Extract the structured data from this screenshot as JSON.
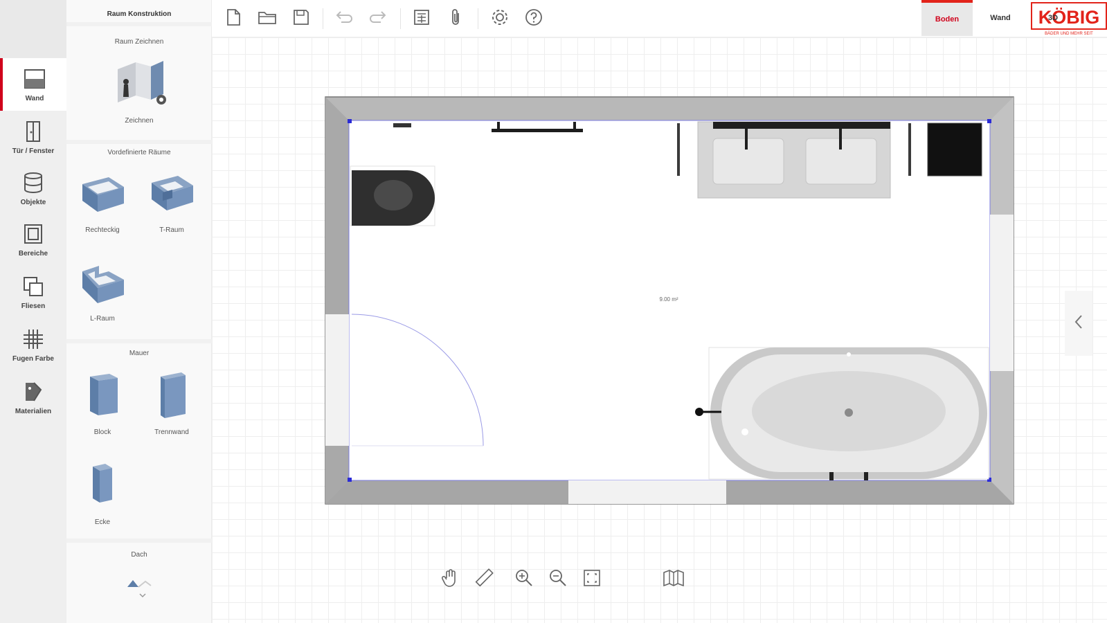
{
  "rail": {
    "items": [
      {
        "label": "Wand",
        "icon": "wall-icon",
        "active": true
      },
      {
        "label": "Tür / Fenster",
        "icon": "door-window-icon"
      },
      {
        "label": "Objekte",
        "icon": "objects-icon"
      },
      {
        "label": "Bereiche",
        "icon": "areas-icon"
      },
      {
        "label": "Fliesen",
        "icon": "tiles-icon"
      },
      {
        "label": "Fugen Farbe",
        "icon": "grout-color-icon"
      },
      {
        "label": "Materialien",
        "icon": "materials-icon"
      }
    ]
  },
  "panel": {
    "title": "Raum Konstruktion",
    "draw_section": "Raum Zeichnen",
    "draw_item": "Zeichnen",
    "predefined_section": "Vordefinierte Räume",
    "predefined": [
      "Rechteckig",
      "T-Raum",
      "L-Raum"
    ],
    "wall_section": "Mauer",
    "walls": [
      "Block",
      "Trennwand",
      "Ecke"
    ],
    "roof_section": "Dach"
  },
  "toolbar": {
    "icons": [
      "new-file-icon",
      "open-folder-icon",
      "save-icon",
      "undo-icon",
      "redo-icon",
      "calculator-icon",
      "attachment-icon",
      "settings-icon",
      "help-icon"
    ]
  },
  "logo": {
    "text": "KÖBIG",
    "tagline": "BÄDER UND MEHR SEIT"
  },
  "views": {
    "tabs": [
      "Boden",
      "Wand",
      "3D"
    ],
    "active": "Boden"
  },
  "plan": {
    "area_label": "9.00 m²"
  },
  "bottom_tools": [
    "pan-hand-icon",
    "measure-ruler-icon",
    "zoom-in-icon",
    "zoom-out-icon",
    "fit-screen-icon",
    "map-book-icon"
  ],
  "colors": {
    "accent": "#e2231a",
    "wall": "#b8b8b8",
    "rail_bg": "#efefef"
  }
}
